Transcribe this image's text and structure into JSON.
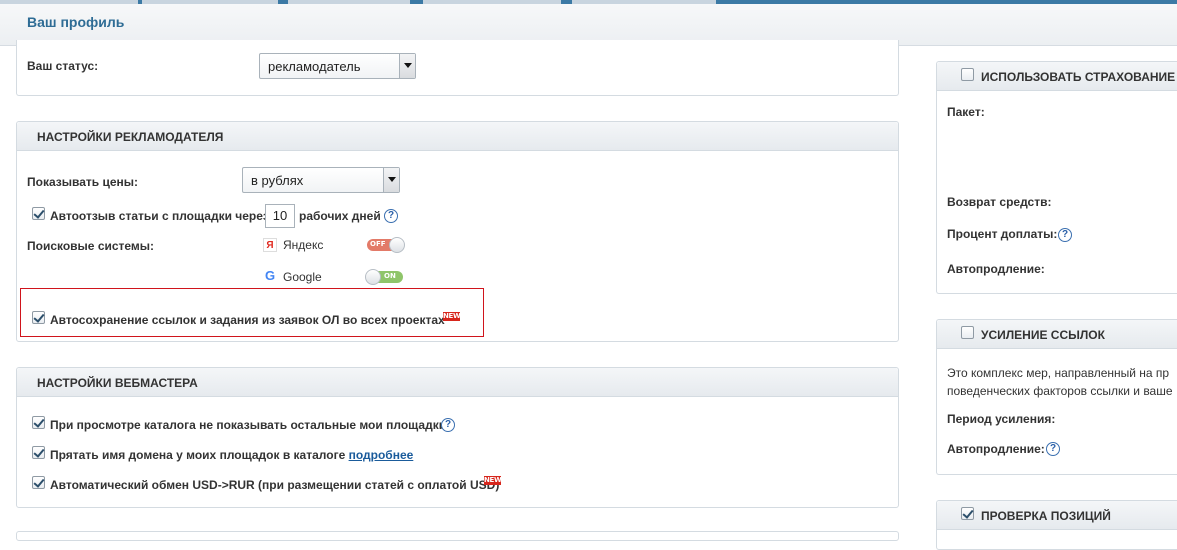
{
  "page": {
    "title": "Ваш профиль"
  },
  "status": {
    "label": "Ваш статус:",
    "value": "рекламодатель"
  },
  "advertiser": {
    "title": "НАСТРОЙКИ РЕКЛАМОДАТЕЛЯ",
    "prices_label": "Показывать цены:",
    "prices_value": "в рублях",
    "autoreview_label": "Автоотзыв статьи с площадки через",
    "autoreview_days": "10",
    "autoreview_suffix": "рабочих дней",
    "search_label": "Поисковые системы:",
    "engines": [
      {
        "name": "Яндекс",
        "icon": "Я",
        "toggle": "OFF",
        "state": "off",
        "color": "#e06060"
      },
      {
        "name": "Google",
        "icon": "G",
        "toggle": "ON",
        "state": "on",
        "color": "#8fc56a"
      }
    ],
    "autosave_label": "Автосохранение ссылок и задания из заявок ОЛ во всех проектах",
    "new_badge": "NEW"
  },
  "webmaster": {
    "title": "НАСТРОЙКИ ВЕБМАСТЕРА",
    "opt1": "При просмотре каталога не показывать остальные мои площадки",
    "opt2": "Прятать имя домена у моих площадок в каталоге",
    "opt2_link": "подробнее",
    "opt3": "Автоматический обмен USD->RUR (при размещении статей с оплатой USD)",
    "new_badge": "NEW"
  },
  "insurance": {
    "title": "ИСПОЛЬЗОВАТЬ СТРАХОВАНИЕ СТ",
    "package_label": "Пакет:",
    "refund_label": "Возврат средств:",
    "surcharge_label": "Процент доплаты:",
    "autorenew_label": "Автопродление:"
  },
  "boost": {
    "title": "УСИЛЕНИЕ ССЫЛОК",
    "desc1": "Это комплекс мер, направленный на пр",
    "desc2": "поведенческих факторов ссылки и ваше",
    "period_label": "Период усиления:",
    "autorenew_label": "Автопродление:"
  },
  "positions": {
    "title": "ПРОВЕРКА ПОЗИЦИЙ"
  },
  "help_glyph": "?"
}
